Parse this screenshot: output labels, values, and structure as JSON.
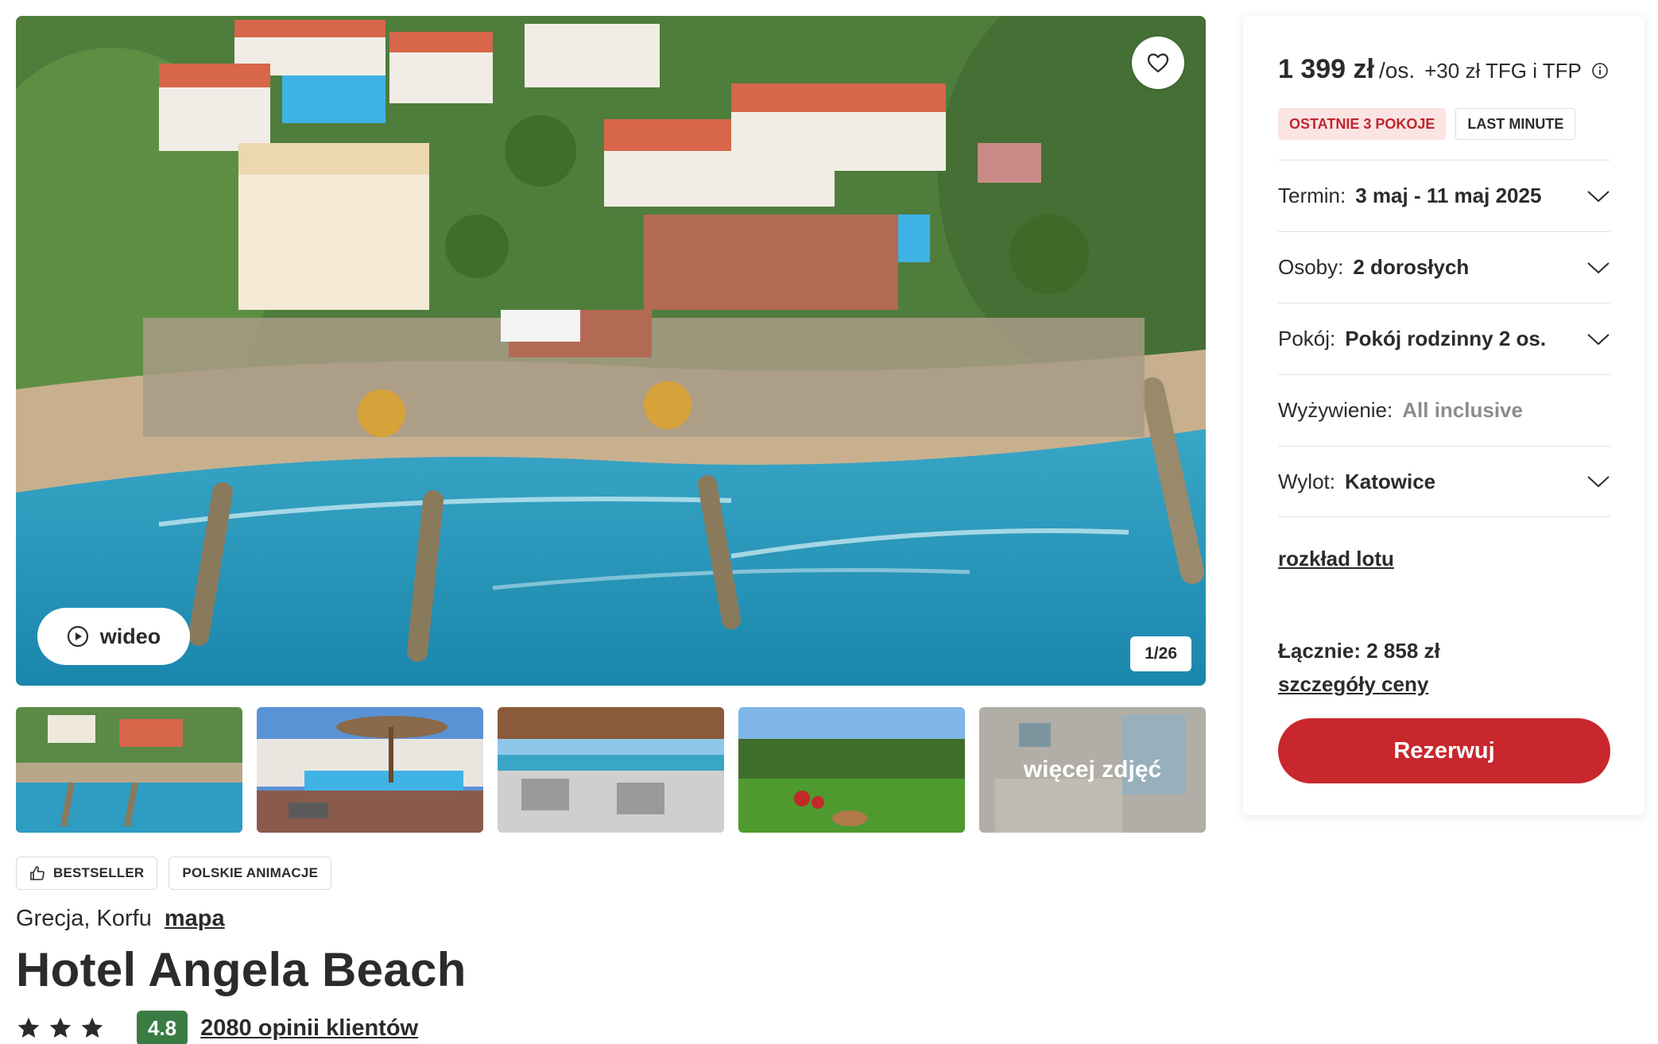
{
  "gallery": {
    "video_label": "wideo",
    "counter": "1/26",
    "more_photos_label": "więcej zdjęć",
    "favorite_icon": "heart-icon",
    "video_icon": "play-circle-icon"
  },
  "tags": [
    {
      "label": "BESTSELLER",
      "icon": "thumbs-up-icon"
    },
    {
      "label": "POLSKIE ANIMACJE"
    }
  ],
  "hotel": {
    "location": "Grecja, Korfu",
    "map_link": "mapa",
    "name": "Hotel Angela Beach",
    "stars": 3,
    "rating": "4.8",
    "reviews": "2080 opinii klientów"
  },
  "booking": {
    "price": "1 399 zł",
    "per_person": "/os.",
    "fee": "+30 zł TFG i TFP",
    "badges": [
      "OSTATNIE 3 POKOJE",
      "LAST MINUTE"
    ],
    "options": [
      {
        "label": "Termin:",
        "value": "3 maj - 11 maj 2025"
      },
      {
        "label": "Osoby:",
        "value": "2 dorosłych"
      },
      {
        "label": "Pokój:",
        "value": "Pokój rodzinny 2 os."
      },
      {
        "label": "Wyżywienie:",
        "value": "All inclusive"
      },
      {
        "label": "Wylot:",
        "value": "Katowice"
      }
    ],
    "flight_link": "rozkład lotu",
    "total": "Łącznie: 2 858 zł",
    "price_details_link": "szczegóły ceny",
    "book_button": "Rezerwuj"
  },
  "colors": {
    "accent_red": "#c8272d",
    "badge_red_bg": "#fbe4e4",
    "rating_green": "#3a7d44",
    "text": "#2b2b2b",
    "muted": "#8c8c8c"
  }
}
